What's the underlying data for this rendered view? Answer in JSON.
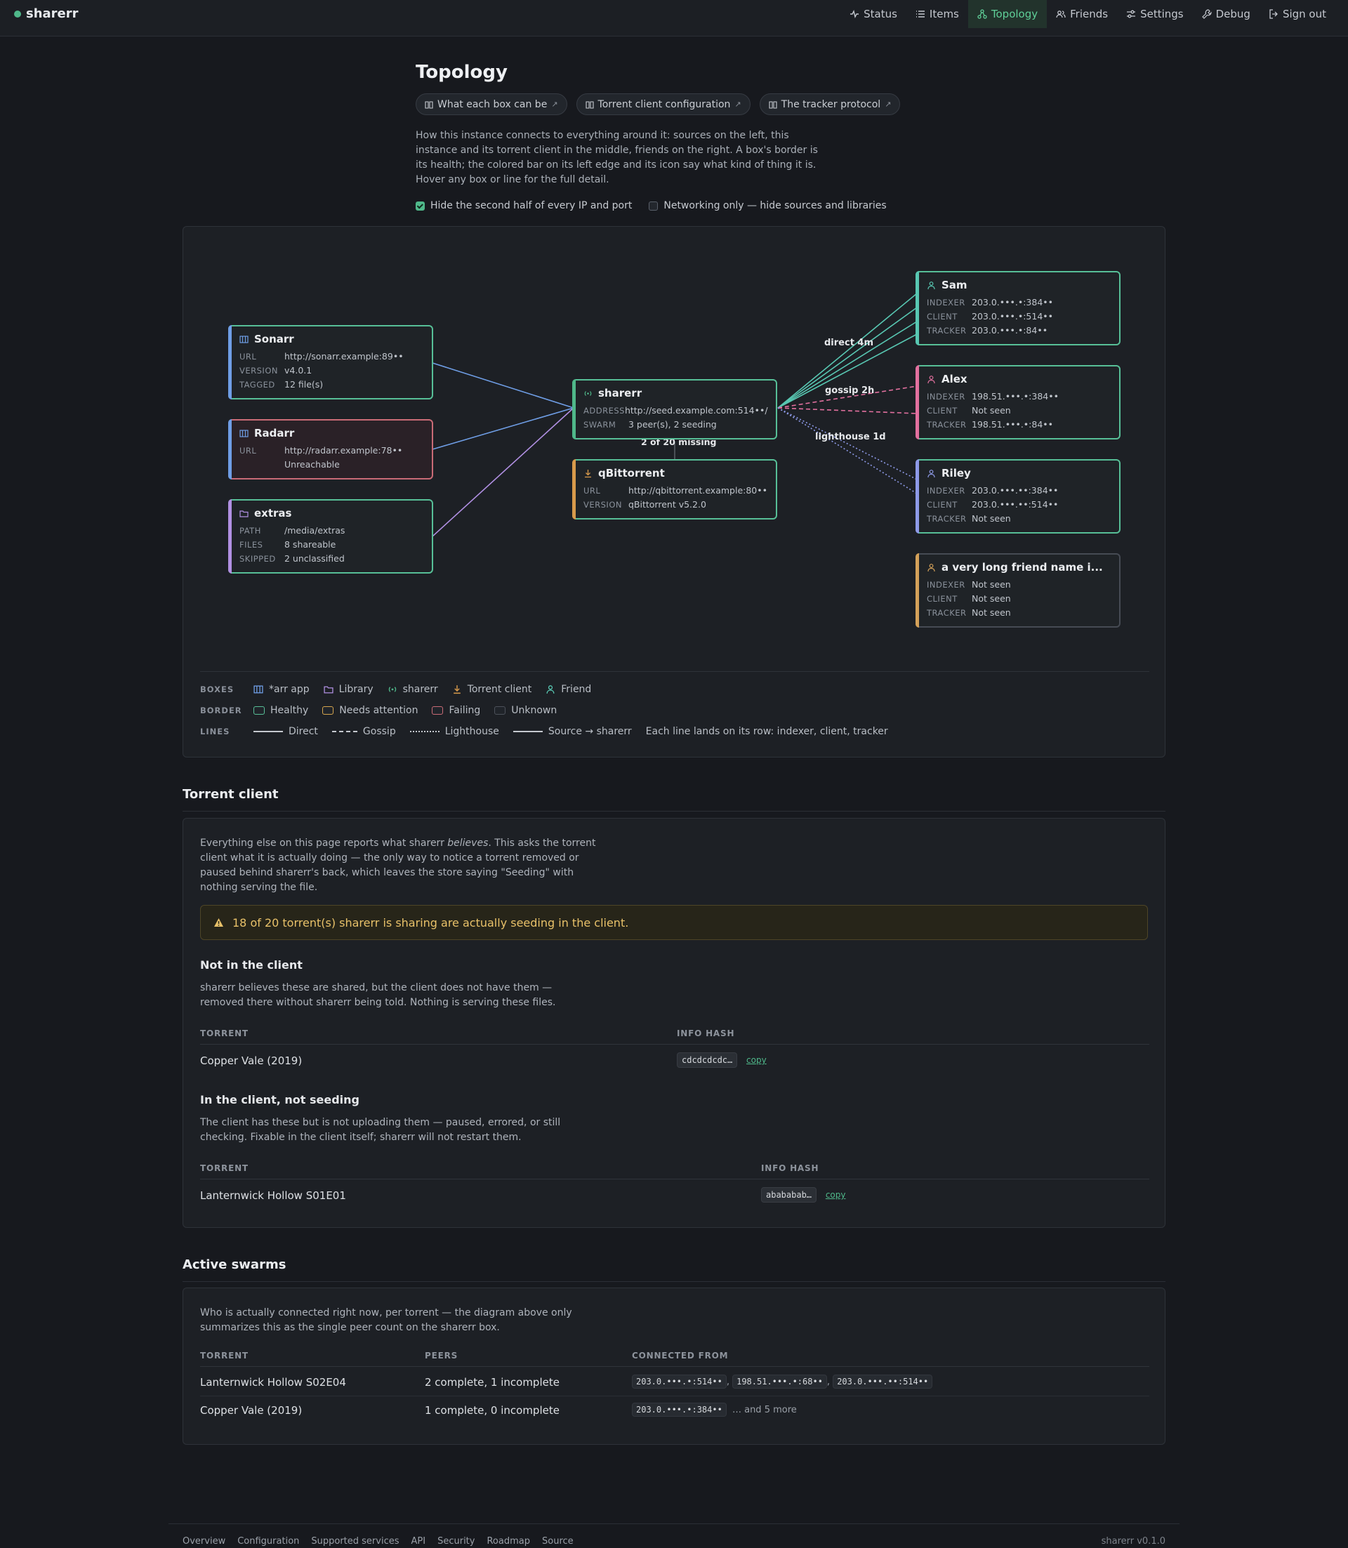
{
  "app": {
    "name": "sharerr"
  },
  "nav": [
    "Status",
    "Items",
    "Topology",
    "Friends",
    "Settings",
    "Debug",
    "Sign out"
  ],
  "page": {
    "title": "Topology",
    "pills": [
      "What each box can be",
      "Torrent client configuration",
      "The tracker protocol"
    ],
    "description": "How this instance connects to everything around it: sources on the left, this instance and its torrent client in the middle, friends on the right. A box's border is its health; the colored bar on its left edge and its icon say what kind of thing it is. Hover any box or line for the full detail.",
    "checkbox_hide_ip": "Hide the second half of every IP and port",
    "checkbox_networking": "Networking only — hide sources and libraries"
  },
  "colors": {
    "arr": "#6f9ee6",
    "library": "#b190e3",
    "sharerr": "#4fb88a",
    "client": "#d89a4b",
    "friend_sam": "#58c7b2",
    "friend_alex": "#e2709f",
    "friend_riley": "#8e9ae8",
    "friend_long": "#d4a159",
    "healthy": "#57bf97",
    "attention": "#d6a54e",
    "failing": "#c96b76",
    "unknown": "#4c515a"
  },
  "topology": {
    "sonarr": {
      "name": "Sonarr",
      "url": "http://sonarr.example:89••",
      "version": "v4.0.1",
      "tagged": "12 file(s)"
    },
    "radarr": {
      "name": "Radarr",
      "url": "http://radarr.example:78••",
      "status": "Unreachable"
    },
    "extras": {
      "name": "extras",
      "path": "/media/extras",
      "files": "8 shareable",
      "skipped": "2 unclassified"
    },
    "sharerr": {
      "name": "sharerr",
      "address": "http://seed.example.com:514••/",
      "swarm": "3 peer(s), 2 seeding"
    },
    "missing_label": "2 of 20 missing",
    "qbittorrent": {
      "name": "qBittorrent",
      "url": "http://qbittorrent.example:80••",
      "version": "qBittorrent v5.2.0"
    },
    "friends": {
      "sam": {
        "name": "Sam",
        "indexer": "203.0.•••.•:384••",
        "client": "203.0.•••.•:514••",
        "tracker": "203.0.•••.•:84••"
      },
      "alex": {
        "name": "Alex",
        "indexer": "198.51.•••.•:384••",
        "client": "Not seen",
        "tracker": "198.51.•••.•:84••"
      },
      "riley": {
        "name": "Riley",
        "indexer": "203.0.•••.••:384••",
        "client": "203.0.•••.••:514••",
        "tracker": "Not seen"
      },
      "long": {
        "name": "a very long friend name i...",
        "indexer": "Not seen",
        "client": "Not seen",
        "tracker": "Not seen"
      }
    },
    "edge_labels": {
      "direct": "direct 4m",
      "gossip": "gossip 2h",
      "lighthouse": "lighthouse 1d"
    },
    "row_labels": {
      "url": "URL",
      "version": "VERSION",
      "tagged": "TAGGED",
      "path": "PATH",
      "files": "FILES",
      "skipped": "SKIPPED",
      "address": "ADDRESS",
      "swarm": "SWARM",
      "indexer": "INDEXER",
      "client": "CLIENT",
      "tracker": "TRACKER"
    }
  },
  "legend": {
    "boxes_label": "BOXES",
    "boxes": [
      "*arr app",
      "Library",
      "sharerr",
      "Torrent client",
      "Friend"
    ],
    "border_label": "BORDER",
    "borders": [
      "Healthy",
      "Needs attention",
      "Failing",
      "Unknown"
    ],
    "lines_label": "LINES",
    "lines": [
      "Direct",
      "Gossip",
      "Lighthouse",
      "Source → sharerr"
    ],
    "lines_note": "Each line lands on its row: indexer, client, tracker"
  },
  "torrent_client": {
    "heading": "Torrent client",
    "intro_1": "Everything else on this page reports what sharerr ",
    "intro_em": "believes",
    "intro_2": ". This asks the torrent client what it is actually doing — the only way to notice a torrent removed or paused behind sharerr's back, which leaves the store saying \"Seeding\" with nothing serving the file.",
    "warning": "18 of 20 torrent(s) sharerr is sharing are actually seeding in the client.",
    "not_in_client": {
      "heading": "Not in the client",
      "text": "sharerr believes these are shared, but the client does not have them — removed there without sharerr being told. Nothing is serving these files.",
      "columns": [
        "TORRENT",
        "INFO HASH"
      ],
      "rows": [
        {
          "torrent": "Copper Vale (2019)",
          "hash": "cdcdcdcdc…",
          "copy": "copy"
        }
      ]
    },
    "not_seeding": {
      "heading": "In the client, not seeding",
      "text": "The client has these but is not uploading them — paused, errored, or still checking. Fixable in the client itself; sharerr will not restart them.",
      "columns": [
        "TORRENT",
        "INFO HASH"
      ],
      "rows": [
        {
          "torrent": "Lanternwick Hollow S01E01",
          "hash": "abababab…",
          "copy": "copy"
        }
      ]
    }
  },
  "active_swarms": {
    "heading": "Active swarms",
    "text": "Who is actually connected right now, per torrent — the diagram above only summarizes this as the single peer count on the sharerr box.",
    "columns": [
      "TORRENT",
      "PEERS",
      "CONNECTED FROM"
    ],
    "rows": [
      {
        "torrent": "Lanternwick Hollow S02E04",
        "peers": "2 complete, 1 incomplete",
        "from": [
          "203.0.•••.•:514••",
          "198.51.•••.•:68••",
          "203.0.•••.••:514••"
        ],
        "more": ""
      },
      {
        "torrent": "Copper Vale (2019)",
        "peers": "1 complete, 0 incomplete",
        "from": [
          "203.0.•••.•:384••"
        ],
        "more": "… and 5 more"
      }
    ]
  },
  "footer": {
    "links": [
      "Overview",
      "Configuration",
      "Supported services",
      "API",
      "Security",
      "Roadmap",
      "Source"
    ],
    "version": "sharerr v0.1.0"
  }
}
